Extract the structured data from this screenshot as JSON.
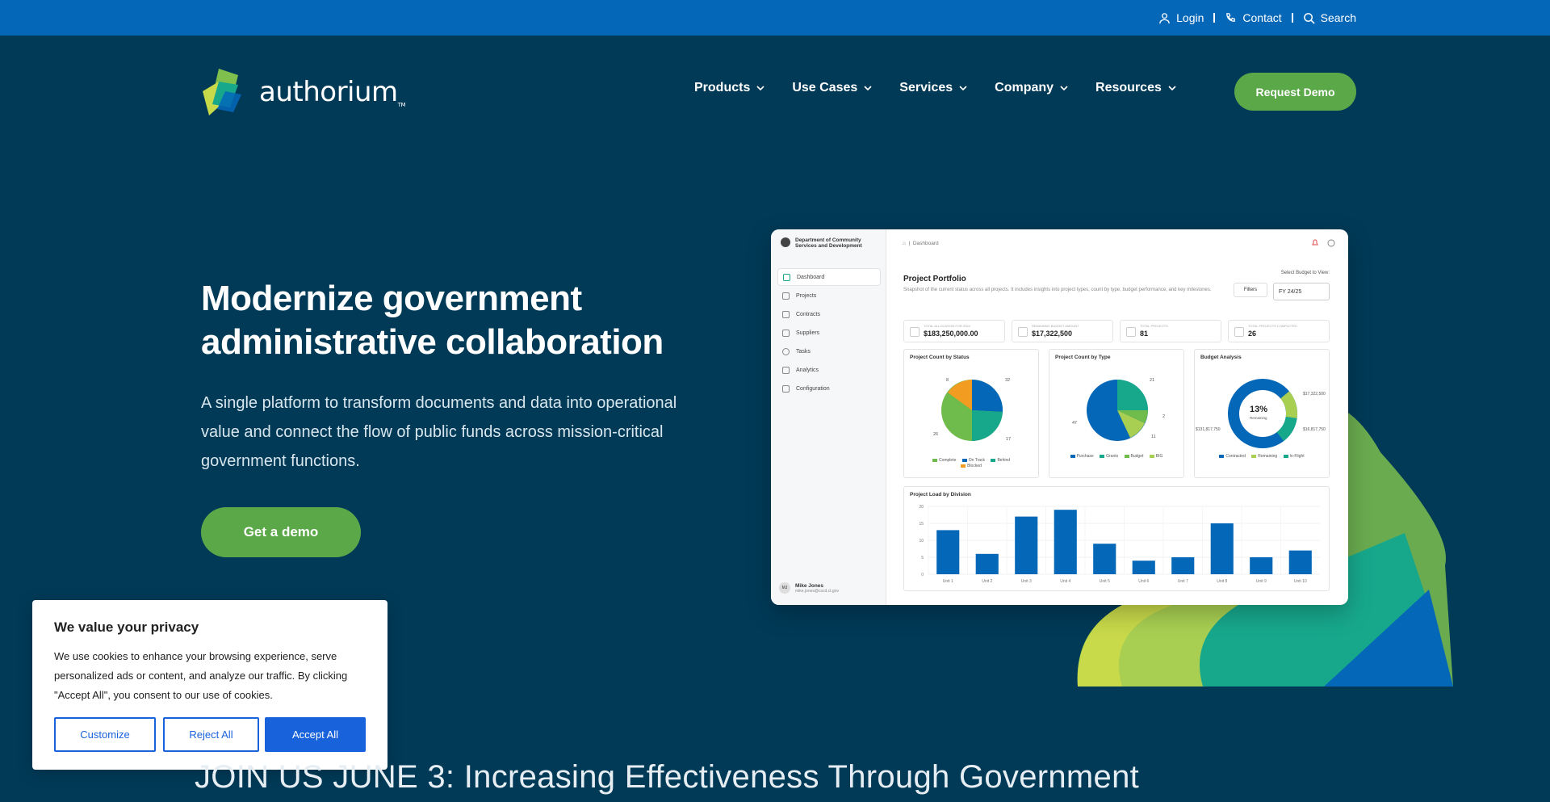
{
  "utility": {
    "login": "Login",
    "contact": "Contact",
    "search": "Search"
  },
  "brand": {
    "name": "authorium",
    "tm": "TM"
  },
  "nav": {
    "items": [
      "Products",
      "Use Cases",
      "Services",
      "Company",
      "Resources"
    ],
    "cta": "Request Demo"
  },
  "hero": {
    "title": "Modernize government administrative collaboration",
    "subtitle": "A single platform to transform documents and data into operational value and connect the flow of public funds across mission-critical government functions.",
    "cta": "Get a demo"
  },
  "dashboard": {
    "org": "Department of Community Services and Development",
    "menu": [
      "Dashboard",
      "Projects",
      "Contracts",
      "Suppliers",
      "Tasks",
      "Analytics",
      "Configuration"
    ],
    "user_name": "Mike Jones",
    "user_initials": "MJ",
    "user_email": "mike.jones@cscd.ct.gov",
    "crumb": "Dashboard",
    "title": "Project Portfolio",
    "desc": "Snapshot of the current status across all projects. It includes insights into project types, count by type, budget performance, and key milestones.",
    "select_label": "Select Budget to View:",
    "filters": "Filters",
    "fy": "FY 24/25",
    "stats": [
      {
        "label": "TOTAL ALLOCATION FOR 2024",
        "value": "$183,250,000.00"
      },
      {
        "label": "REMAINING BUDGET AMOUNT",
        "value": "$17,322,500"
      },
      {
        "label": "TOTAL PROJECTS",
        "value": "81"
      },
      {
        "label": "TOTAL PROJECTS COMPLETED",
        "value": "26"
      }
    ],
    "card_status": "Project Count by Status",
    "card_type": "Project Count by Type",
    "card_budget": "Budget Analysis",
    "bar_title": "Project Load by Division",
    "status_labels": {
      "a": "8",
      "b": "32",
      "c": "26",
      "d": "17"
    },
    "status_legend": [
      "Complete",
      "On Track",
      "Behind",
      "Blocked"
    ],
    "type_labels": {
      "a": "21",
      "b": "2",
      "c": "47",
      "d": "11"
    },
    "type_legend": [
      "Purchase",
      "Grants",
      "Budget",
      "BIG"
    ],
    "budget_center": "13%",
    "budget_center_sub": "Remaining",
    "budget_labels": {
      "a": "$17,322,500",
      "b": "$131,817,750",
      "c": "$16,817,750"
    },
    "budget_legend": [
      "Contracted",
      "Remaining",
      "In-Flight"
    ],
    "colors": {
      "blue": "#0467b8",
      "teal": "#17a88c",
      "green": "#6fbb4b",
      "lime": "#a8cf52",
      "orange": "#f29d22"
    }
  },
  "chart_data": {
    "type": "bar",
    "title": "Project Load by Division",
    "categories": [
      "Unit 1",
      "Unit 2",
      "Unit 3",
      "Unit 4",
      "Unit 5",
      "Unit 6",
      "Unit 7",
      "Unit 8",
      "Unit 9",
      "Unit 10"
    ],
    "values": [
      13,
      6,
      17,
      19,
      9,
      4,
      5,
      15,
      5,
      7
    ],
    "ylim": [
      0,
      20
    ],
    "yticks": [
      "0",
      "5",
      "10",
      "15",
      "20"
    ]
  },
  "cookie": {
    "title": "We value your privacy",
    "body": "We use cookies to enhance your browsing experience, serve personalized ads or content, and analyze our traffic. By clicking \"Accept All\", you consent to our use of cookies.",
    "customize": "Customize",
    "reject": "Reject All",
    "accept": "Accept All"
  },
  "banner": {
    "text": "JOIN US JUNE 3: Increasing Effectiveness Through Government"
  }
}
